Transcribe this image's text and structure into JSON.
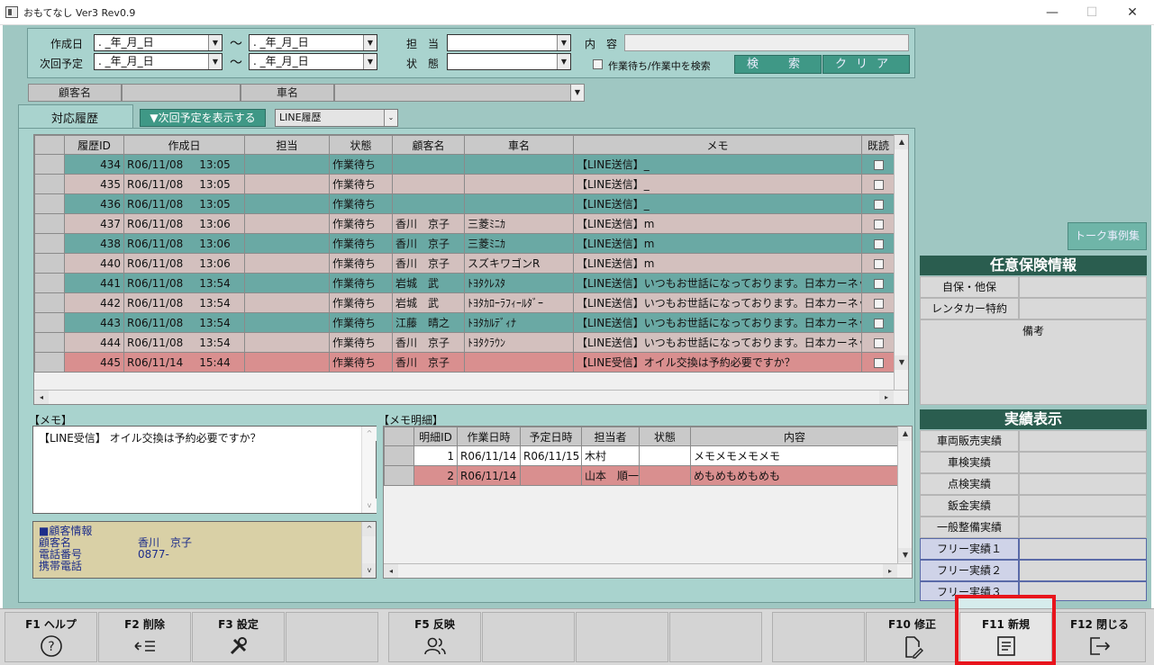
{
  "window": {
    "title": "おもてなし Ver3 Rev0.9",
    "minimize": "—",
    "maximize": "☐",
    "close": "✕"
  },
  "search": {
    "created_label": "作成日",
    "next_label": "次回予定",
    "date_placeholder": ". _年_月_日",
    "tilde": "～",
    "staff_label": "担　当",
    "status_label": "状　態",
    "content_label": "内　容",
    "waiting_checkbox_label": "作業待ち/作業中を検索",
    "search_button": "検　索",
    "clear_button": "クリア",
    "customer_label": "顧客名",
    "car_label": "車名"
  },
  "tabs": {
    "history_tab": "対応履歴",
    "show_next_button": "▼次回予定を表示する",
    "line_select_value": "LINE履歴"
  },
  "history_table": {
    "columns": [
      "履歴ID",
      "作成日",
      "担当",
      "状態",
      "顧客名",
      "車名",
      "メモ",
      "既読"
    ],
    "rows": [
      {
        "id": "434",
        "date": "R06/11/08",
        "time": "13:05",
        "staff": "",
        "status": "作業待ち",
        "customer": "",
        "car": "",
        "memo": "【LINE送信】_",
        "style": "a"
      },
      {
        "id": "435",
        "date": "R06/11/08",
        "time": "13:05",
        "staff": "",
        "status": "作業待ち",
        "customer": "",
        "car": "",
        "memo": "【LINE送信】_",
        "style": "b"
      },
      {
        "id": "436",
        "date": "R06/11/08",
        "time": "13:05",
        "staff": "",
        "status": "作業待ち",
        "customer": "",
        "car": "",
        "memo": "【LINE送信】_",
        "style": "a"
      },
      {
        "id": "437",
        "date": "R06/11/08",
        "time": "13:06",
        "staff": "",
        "status": "作業待ち",
        "customer": "香川　京子",
        "car": "三菱ﾐﾆｶ",
        "memo": "【LINE送信】m",
        "style": "b"
      },
      {
        "id": "438",
        "date": "R06/11/08",
        "time": "13:06",
        "staff": "",
        "status": "作業待ち",
        "customer": "香川　京子",
        "car": "三菱ﾐﾆｶ",
        "memo": "【LINE送信】m",
        "style": "a"
      },
      {
        "id": "440",
        "date": "R06/11/08",
        "time": "13:06",
        "staff": "",
        "status": "作業待ち",
        "customer": "香川　京子",
        "car": "スズキワゴンR",
        "memo": "【LINE送信】m",
        "style": "b"
      },
      {
        "id": "441",
        "date": "R06/11/08",
        "time": "13:54",
        "staff": "",
        "status": "作業待ち",
        "customer": "岩城　武",
        "car": "ﾄﾖﾀｸﾚｽﾀ",
        "memo": "【LINE送信】いつもお世話になっております。日本カーネッ",
        "style": "a"
      },
      {
        "id": "442",
        "date": "R06/11/08",
        "time": "13:54",
        "staff": "",
        "status": "作業待ち",
        "customer": "岩城　武",
        "car": "ﾄﾖﾀｶﾛｰﾗﾌｨｰﾙﾀﾞｰ",
        "memo": "【LINE送信】いつもお世話になっております。日本カーネッ",
        "style": "b"
      },
      {
        "id": "443",
        "date": "R06/11/08",
        "time": "13:54",
        "staff": "",
        "status": "作業待ち",
        "customer": "江藤　晴之",
        "car": "ﾄﾖﾀｶﾙﾃﾞｨﾅ",
        "memo": "【LINE送信】いつもお世話になっております。日本カーネッ",
        "style": "a"
      },
      {
        "id": "444",
        "date": "R06/11/08",
        "time": "13:54",
        "staff": "",
        "status": "作業待ち",
        "customer": "香川　京子",
        "car": "ﾄﾖﾀｸﾗｳﾝ",
        "memo": "【LINE送信】いつもお世話になっております。日本カーネッ",
        "style": "b"
      },
      {
        "id": "445",
        "date": "R06/11/14",
        "time": "15:44",
        "staff": "",
        "status": "作業待ち",
        "customer": "香川　京子",
        "car": "",
        "memo": "【LINE受信】オイル交換は予約必要ですか？",
        "style": "r"
      }
    ]
  },
  "memo": {
    "label": "【メモ】",
    "text": "【LINE受信】 オイル交換は予約必要ですか？"
  },
  "customer_info": {
    "heading": "■顧客情報",
    "name_label": "顧客名",
    "name_value": "香川　京子",
    "phone_label": "電話番号",
    "phone_value": "0877-",
    "mobile_label": "携帯電話"
  },
  "memo_detail": {
    "label": "【メモ明細】",
    "columns": [
      "明細ID",
      "作業日時",
      "予定日時",
      "担当者",
      "状態",
      "内容"
    ],
    "rows": [
      {
        "id": "1",
        "work": "R06/11/14",
        "plan": "R06/11/15",
        "staff": "木村",
        "status": "",
        "content": "メモメモメモメモ",
        "style": "w"
      },
      {
        "id": "2",
        "work": "R06/11/14",
        "plan": "",
        "staff": "山本　順一",
        "status": "",
        "content": "めもめもめもめも",
        "style": "r"
      }
    ]
  },
  "right": {
    "talk_button": "トーク事例集",
    "insurance_heading": "任意保険情報",
    "insurance_rows": [
      "自保・他保",
      "レンタカー特約"
    ],
    "remarks_label": "備考",
    "results_heading": "実績表示",
    "results_rows": [
      "車両販売実績",
      "車検実績",
      "点検実績",
      "鈑金実績",
      "一般整備実績"
    ],
    "free_rows": [
      "フリー実績１",
      "フリー実績２",
      "フリー実績３"
    ]
  },
  "fkeys": {
    "f1": "F1 ヘルプ",
    "f2": "F2 削除",
    "f3": "F3 設定",
    "f5": "F5 反映",
    "f10": "F10 修正",
    "f11": "F11 新規",
    "f12": "F12 閉じる"
  },
  "colors": {
    "highlight_border": "#e8141c",
    "main_bg": "#9fc7c2",
    "heading_bg": "#2a5d4f"
  }
}
